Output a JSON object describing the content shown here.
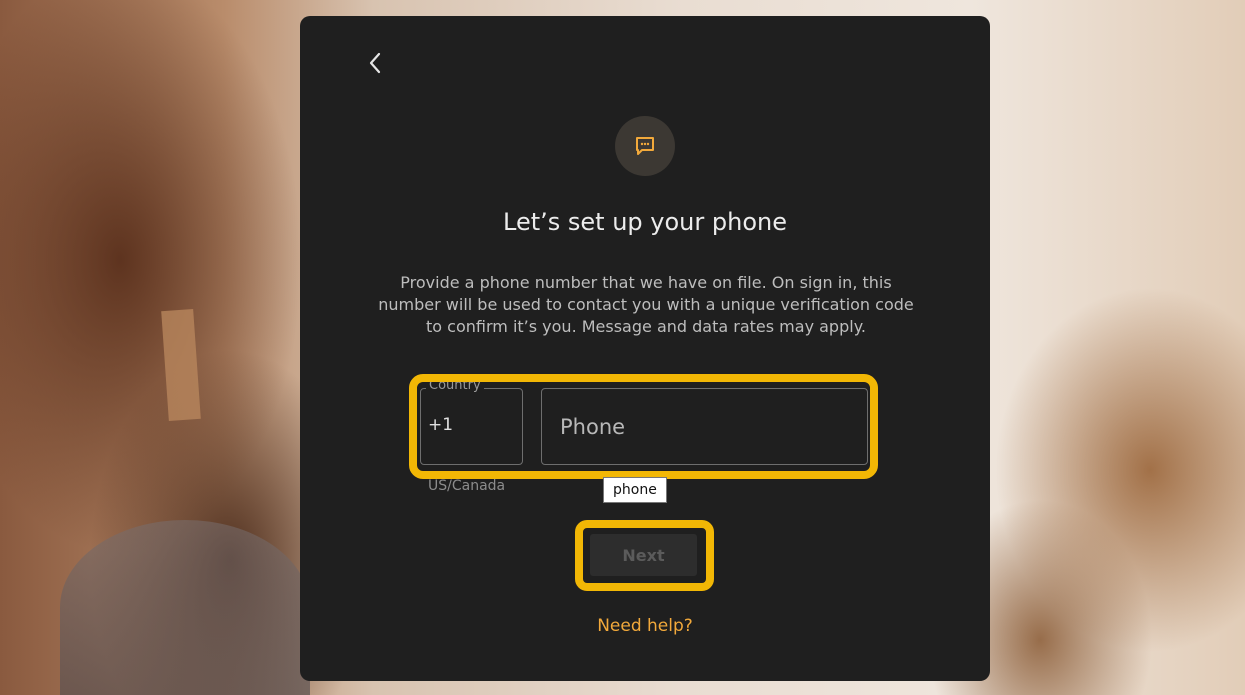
{
  "screen": {
    "title": "Let’s set up your phone",
    "description": "Provide a phone number that we have on file. On sign in, this number will be used to contact you with a unique verification code to confirm it’s you. Message and data rates may apply."
  },
  "country_field": {
    "label": "Country",
    "value": "+1",
    "helper": "US/Canada"
  },
  "phone_field": {
    "placeholder": "Phone",
    "value": ""
  },
  "tooltip": {
    "text": "phone"
  },
  "actions": {
    "next_label": "Next",
    "help_label": "Need help?"
  },
  "colors": {
    "accent": "#f2a93b",
    "highlight": "#f2b705",
    "card_bg": "#1f1f1f"
  },
  "icons": {
    "back": "chevron-left-icon",
    "badge": "chat-bubble-icon"
  }
}
